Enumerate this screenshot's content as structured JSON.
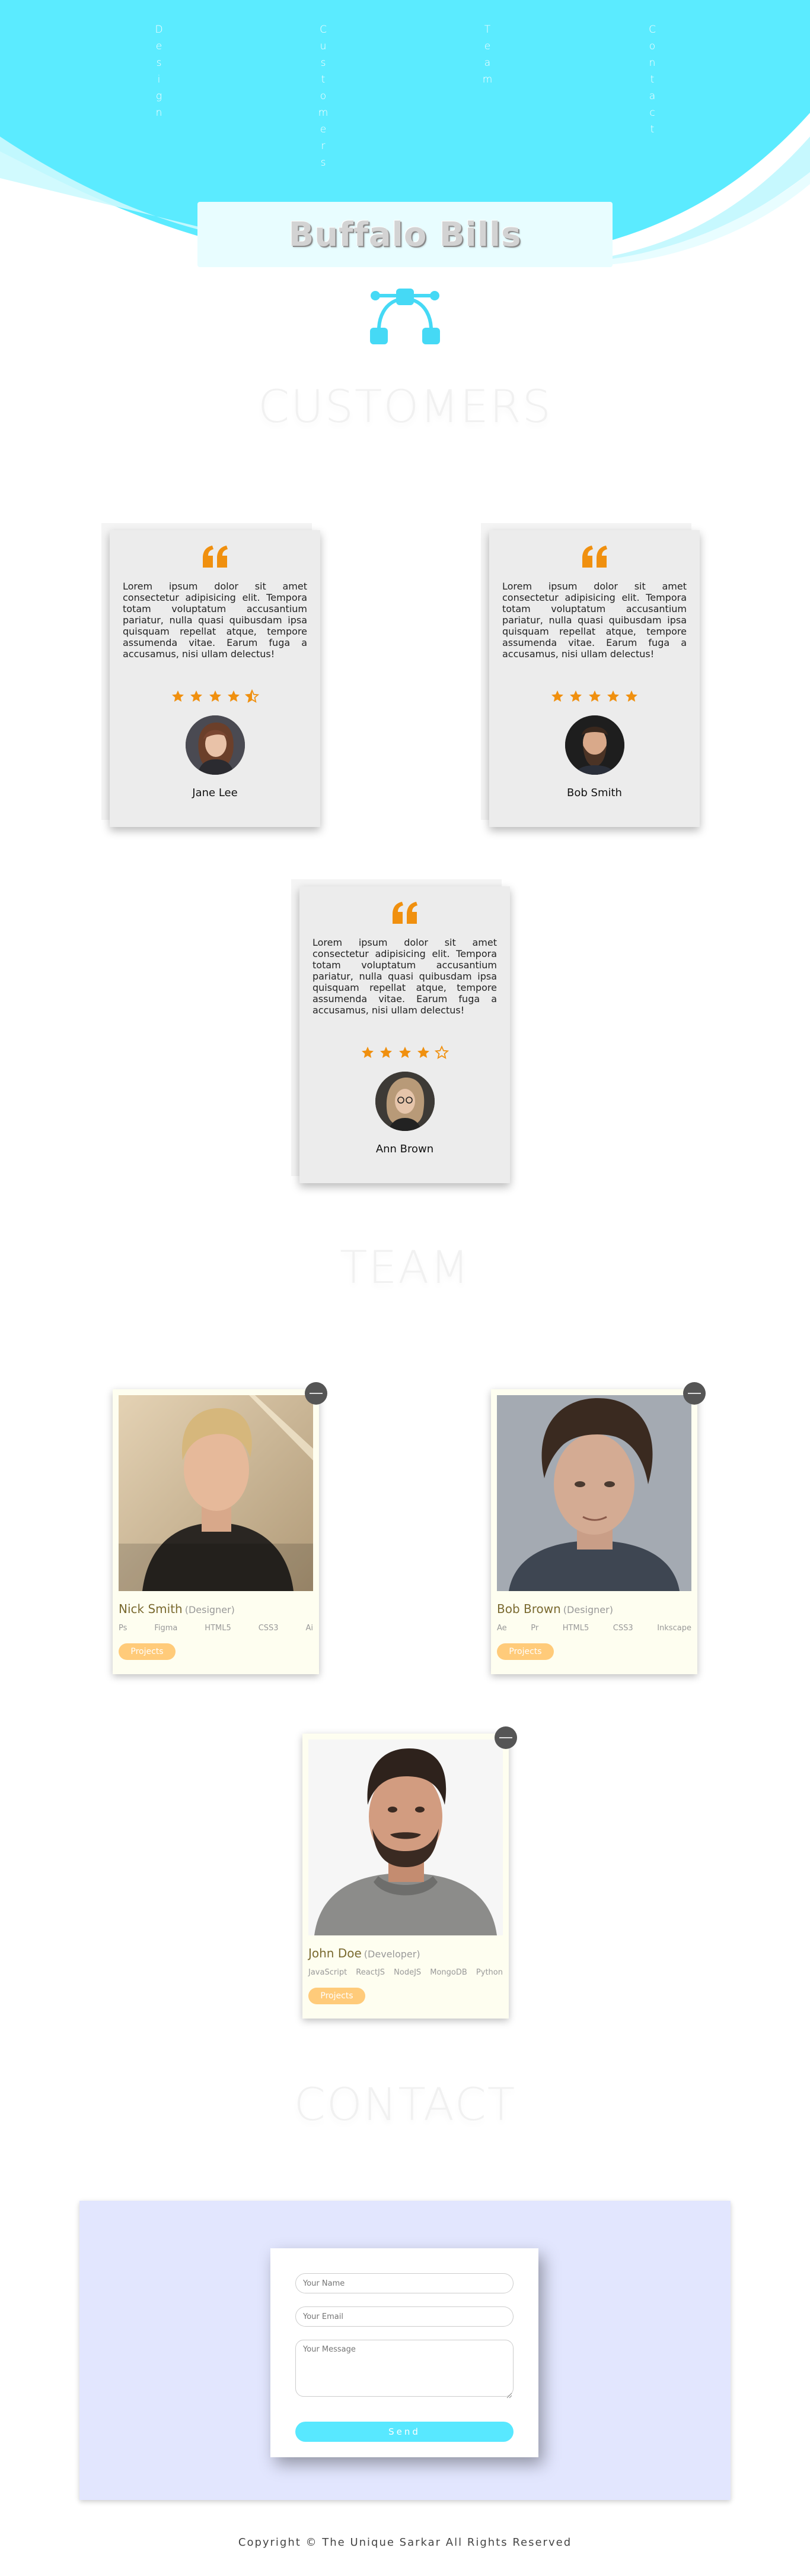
{
  "nav": {
    "items": [
      {
        "label": "Design"
      },
      {
        "label": "Customers"
      },
      {
        "label": "Team"
      },
      {
        "label": "Contact"
      }
    ]
  },
  "brand": {
    "logo_text": "Buffalo Bills",
    "icon": "network-nodes-icon"
  },
  "colors": {
    "accent": "#58e8ff",
    "quote_orange": "#f0900f",
    "contact_bg": "#e2e6fe",
    "projects_button": "#ffcb7a"
  },
  "customers": {
    "title": "CUSTOMERS",
    "testimonials": [
      {
        "text": "Lorem ipsum dolor sit amet consectetur adipisicing elit. Tempora totam voluptatum accusantium pariatur, nulla quasi quibusdam ipsa quisquam repellat atque, tempore assumenda vitae. Earum fuga a accusamus, nisi ullam delectus!",
        "rating": 4.5,
        "name": "Jane Lee",
        "avatar": "woman-avatar"
      },
      {
        "text": "Lorem ipsum dolor sit amet consectetur adipisicing elit. Tempora totam voluptatum accusantium pariatur, nulla quasi quibusdam ipsa quisquam repellat atque, tempore assumenda vitae. Earum fuga a accusamus, nisi ullam delectus!",
        "rating": 5,
        "name": "Bob Smith",
        "avatar": "bearded-man-avatar"
      },
      {
        "text": "Lorem ipsum dolor sit amet consectetur adipisicing elit. Tempora totam voluptatum accusantium pariatur, nulla quasi quibusdam ipsa quisquam repellat atque, tempore assumenda vitae. Earum fuga a accusamus, nisi ullam delectus!",
        "rating": 4,
        "name": "Ann Brown",
        "avatar": "woman-glasses-avatar"
      }
    ]
  },
  "team": {
    "title": "TEAM",
    "members": [
      {
        "name": "Nick Smith",
        "role": "(Designer)",
        "skills": [
          "Ps",
          "Figma",
          "HTML5",
          "CSS3",
          "Ai"
        ],
        "button": "Projects"
      },
      {
        "name": "Bob Brown",
        "role": "(Designer)",
        "skills": [
          "Ae",
          "Pr",
          "HTML5",
          "CSS3",
          "Inkscape"
        ],
        "button": "Projects"
      },
      {
        "name": "John Doe",
        "role": "(Developer)",
        "skills": [
          "JavaScript",
          "ReactJS",
          "NodeJS",
          "MongoDB",
          "Python"
        ],
        "button": "Projects"
      }
    ]
  },
  "contact": {
    "title": "CONTACT",
    "name_placeholder": "Your Name",
    "email_placeholder": "Your Email",
    "message_placeholder": "Your Message",
    "send_label": "Send"
  },
  "footer": {
    "copyright": "Copyright © The Unique Sarkar All Rights Reserved"
  }
}
